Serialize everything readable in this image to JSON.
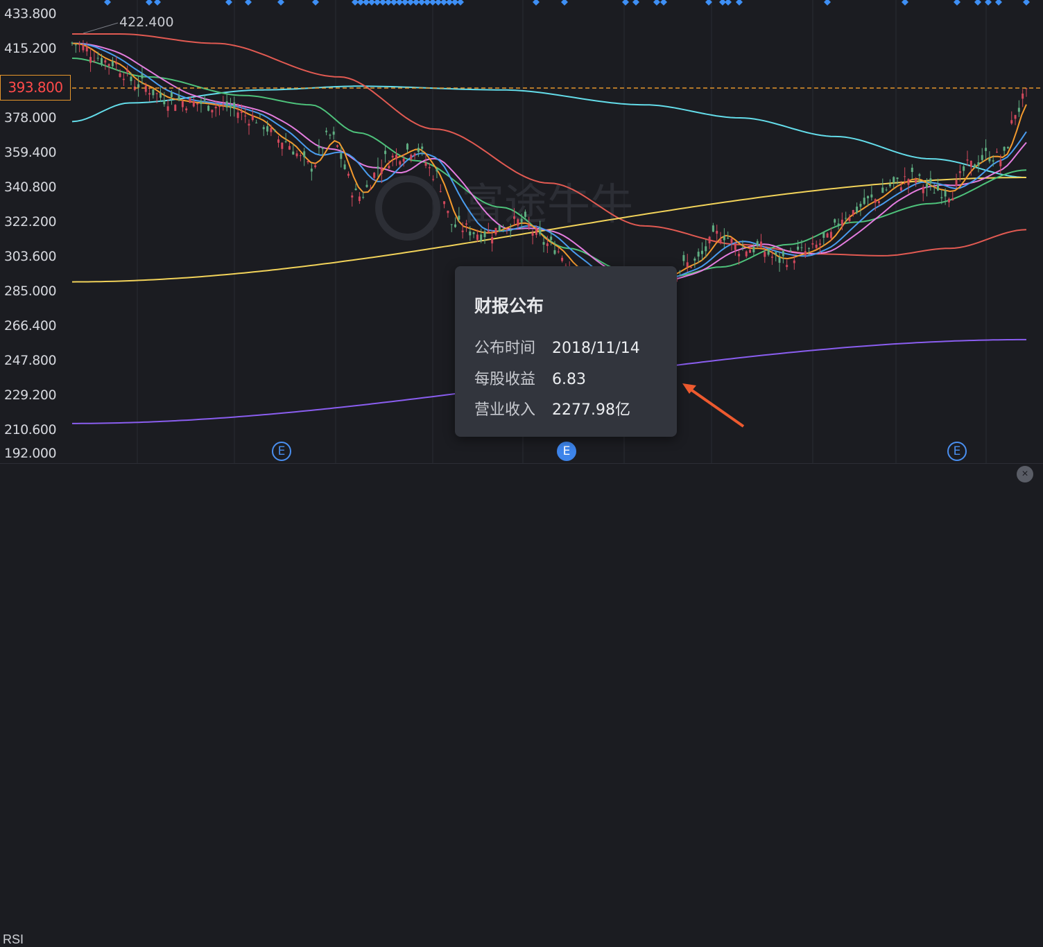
{
  "chart_data": {
    "type": "candlestick",
    "y_axis_ticks": [
      "433.800",
      "415.200",
      "393.800",
      "378.000",
      "359.400",
      "340.800",
      "322.200",
      "303.600",
      "285.000",
      "266.400",
      "247.800",
      "229.200",
      "210.600",
      "192.000"
    ],
    "y_range": [
      192.0,
      433.8
    ],
    "current_price": "393.800",
    "period_high": "422.400",
    "grid": true,
    "line_colors": {
      "ma_orange": "#f39a2e",
      "ma_blue": "#4a9df0",
      "ma_pink": "#e57de0",
      "ma_cyan": "#64ddea",
      "ma_green": "#4ec27b",
      "ma_red": "#e25a52",
      "ma_yellow": "#f2d35a",
      "ma_purple": "#8a5ef0"
    },
    "ma_series": {
      "cyan": [
        [
          0,
          376
        ],
        [
          0.06,
          386
        ],
        [
          0.2,
          393
        ],
        [
          0.3,
          395
        ],
        [
          0.45,
          393
        ],
        [
          0.6,
          385
        ],
        [
          0.7,
          378
        ],
        [
          0.8,
          368
        ],
        [
          0.9,
          356
        ],
        [
          1.0,
          346
        ]
      ],
      "red": [
        [
          0,
          423
        ],
        [
          0.05,
          423
        ],
        [
          0.15,
          418
        ],
        [
          0.28,
          400
        ],
        [
          0.38,
          372
        ],
        [
          0.5,
          343
        ],
        [
          0.6,
          320
        ],
        [
          0.7,
          310
        ],
        [
          0.78,
          305
        ],
        [
          0.85,
          304
        ],
        [
          0.92,
          308
        ],
        [
          1.0,
          318
        ]
      ],
      "yellow": [
        [
          0,
          290
        ],
        [
          1.0,
          346
        ]
      ],
      "purple": [
        [
          0,
          214
        ],
        [
          1.0,
          259
        ]
      ],
      "green": [
        [
          0,
          410
        ],
        [
          0.08,
          400
        ],
        [
          0.18,
          390
        ],
        [
          0.25,
          385
        ],
        [
          0.3,
          370
        ],
        [
          0.36,
          355
        ],
        [
          0.45,
          330
        ],
        [
          0.52,
          308
        ],
        [
          0.58,
          296
        ],
        [
          0.63,
          293
        ],
        [
          0.68,
          298
        ],
        [
          0.75,
          310
        ],
        [
          0.82,
          322
        ],
        [
          0.9,
          332
        ],
        [
          1.0,
          350
        ]
      ]
    }
  },
  "earnings_markers": [
    {
      "label": "E"
    },
    {
      "label": "E"
    },
    {
      "label": "E"
    }
  ],
  "tooltip": {
    "title": "财报公布",
    "rows": [
      {
        "label": "公布时间",
        "value": "2018/11/14"
      },
      {
        "label": "每股收益",
        "value": "6.83"
      },
      {
        "label": "营业收入",
        "value": "2277.98亿"
      }
    ]
  },
  "watermark": "富途牛牛",
  "bottom_bar": {
    "indicator": "RSI"
  }
}
